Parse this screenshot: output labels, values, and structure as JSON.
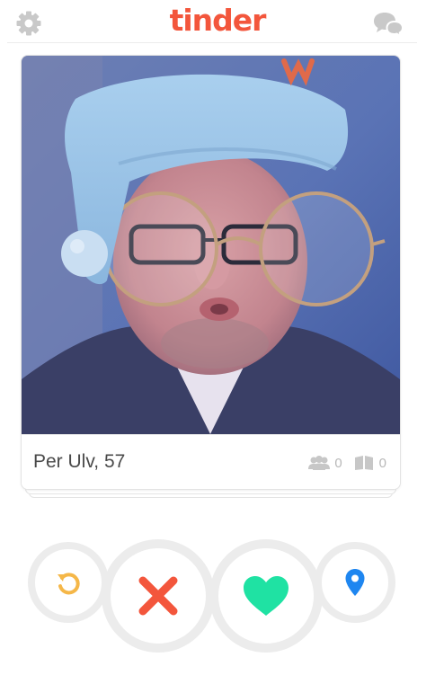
{
  "app": {
    "logo_text": "tinder",
    "brand_color": "#f3563c"
  },
  "header": {
    "left_icon": "gear-icon",
    "right_icon": "chat-bubbles-icon"
  },
  "profile": {
    "name_age": "Per Ulv, 57",
    "shared_friends_count": "0",
    "shared_interests_count": "0"
  },
  "actions": [
    {
      "name": "rewind",
      "icon": "rewind-icon",
      "color": "#f5b748"
    },
    {
      "name": "dislike",
      "icon": "x-icon",
      "color": "#f3563c"
    },
    {
      "name": "like",
      "icon": "heart-icon",
      "color": "#1fe2a3"
    },
    {
      "name": "location",
      "icon": "location-pin-icon",
      "color": "#1e86f0"
    }
  ]
}
